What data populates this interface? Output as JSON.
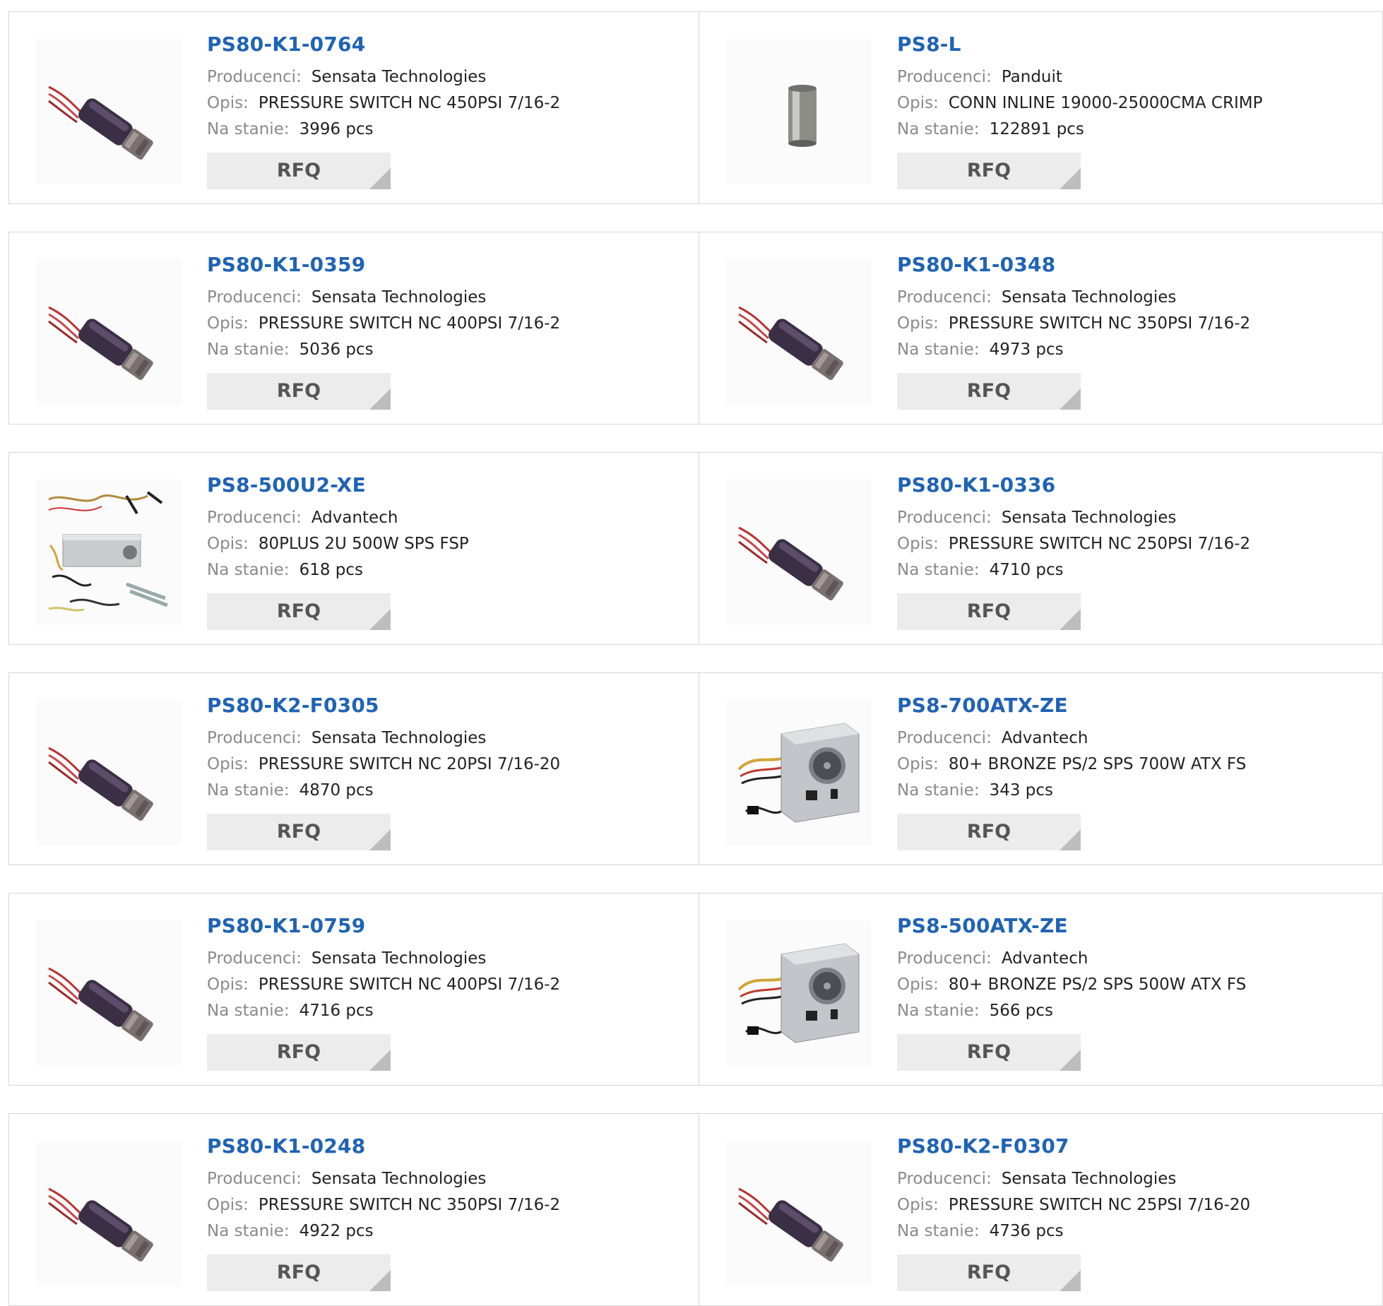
{
  "labels": {
    "manufacturer": "Producenci:",
    "description": "Opis:",
    "stock": "Na stanie:",
    "rfq": "RFQ"
  },
  "products": [
    {
      "pn": "PS80-K1-0764",
      "manufacturer": "Sensata Technologies",
      "description": "PRESSURE SWITCH NC 450PSI 7/16-2",
      "stock": "3996 pcs",
      "image": "pressure-switch"
    },
    {
      "pn": "PS8-L",
      "manufacturer": "Panduit",
      "description": "CONN INLINE 19000-25000CMA CRIMP",
      "stock": "122891 pcs",
      "image": "inline-connector"
    },
    {
      "pn": "PS80-K1-0359",
      "manufacturer": "Sensata Technologies",
      "description": "PRESSURE SWITCH NC 400PSI 7/16-2",
      "stock": "5036 pcs",
      "image": "pressure-switch"
    },
    {
      "pn": "PS80-K1-0348",
      "manufacturer": "Sensata Technologies",
      "description": "PRESSURE SWITCH NC 350PSI 7/16-2",
      "stock": "4973 pcs",
      "image": "pressure-switch"
    },
    {
      "pn": "PS8-500U2-XE",
      "manufacturer": "Advantech",
      "description": "80PLUS 2U 500W SPS FSP",
      "stock": "618 pcs",
      "image": "psu-2u-kit"
    },
    {
      "pn": "PS80-K1-0336",
      "manufacturer": "Sensata Technologies",
      "description": "PRESSURE SWITCH NC 250PSI 7/16-2",
      "stock": "4710 pcs",
      "image": "pressure-switch"
    },
    {
      "pn": "PS80-K2-F0305",
      "manufacturer": "Sensata Technologies",
      "description": "PRESSURE SWITCH NC 20PSI 7/16-20",
      "stock": "4870 pcs",
      "image": "pressure-switch"
    },
    {
      "pn": "PS8-700ATX-ZE",
      "manufacturer": "Advantech",
      "description": "80+ BRONZE PS/2 SPS 700W ATX FS",
      "stock": "343 pcs",
      "image": "atx-psu"
    },
    {
      "pn": "PS80-K1-0759",
      "manufacturer": "Sensata Technologies",
      "description": "PRESSURE SWITCH NC 400PSI 7/16-2",
      "stock": "4716 pcs",
      "image": "pressure-switch"
    },
    {
      "pn": "PS8-500ATX-ZE",
      "manufacturer": "Advantech",
      "description": "80+ BRONZE PS/2 SPS 500W ATX FS",
      "stock": "566 pcs",
      "image": "atx-psu"
    },
    {
      "pn": "PS80-K1-0248",
      "manufacturer": "Sensata Technologies",
      "description": "PRESSURE SWITCH NC 350PSI 7/16-2",
      "stock": "4922 pcs",
      "image": "pressure-switch"
    },
    {
      "pn": "PS80-K2-F0307",
      "manufacturer": "Sensata Technologies",
      "description": "PRESSURE SWITCH NC 25PSI 7/16-20",
      "stock": "4736 pcs",
      "image": "pressure-switch"
    }
  ]
}
